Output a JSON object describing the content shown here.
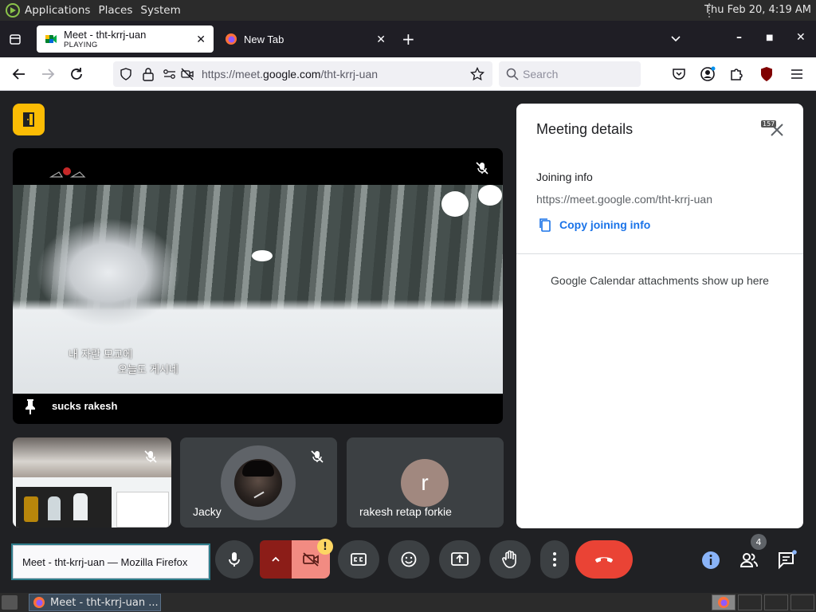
{
  "top_panel": {
    "menus": [
      "Applications",
      "Places",
      "System"
    ],
    "clock": "Thu Feb 20,  4:19 AM"
  },
  "browser": {
    "tabs": [
      {
        "title": "Meet - tht-krrj-uan",
        "subtitle": "PLAYING",
        "icon": "google-meet-icon",
        "active": true
      },
      {
        "title": "New Tab",
        "icon": "firefox-icon",
        "active": false
      }
    ],
    "url_prefix": "https://meet.",
    "url_domain": "google.com",
    "url_path": "/tht-krrj-uan",
    "search_placeholder": "Search",
    "ext_badge": "157"
  },
  "meet": {
    "main_tile": {
      "participant": "sucks rakesh",
      "caption_line1": "내 자란 모교에",
      "caption_line2": "오늘도 게시네"
    },
    "tiles": [
      {
        "participant": ""
      },
      {
        "participant": "Jacky"
      },
      {
        "participant": "rakesh retap forkie",
        "initial": "r",
        "avatar_color": "#a1887f"
      }
    ],
    "details": {
      "title": "Meeting details",
      "joining_heading": "Joining info",
      "meeting_link": "https://meet.google.com/tht-krrj-uan",
      "copy_label": "Copy joining info",
      "calendar_note": "Google Calendar attachments show up here"
    },
    "people_count": "4",
    "warning_badge": "!"
  },
  "tooltip": "Meet - tht-krrj-uan — Mozilla Firefox",
  "taskbar": {
    "window_label": "Meet - tht-krrj-uan ..."
  },
  "colors": {
    "meet_bg": "#202124",
    "end_call": "#ea4335",
    "accent_blue": "#1a73e8",
    "room_button": "#fbbc04"
  }
}
